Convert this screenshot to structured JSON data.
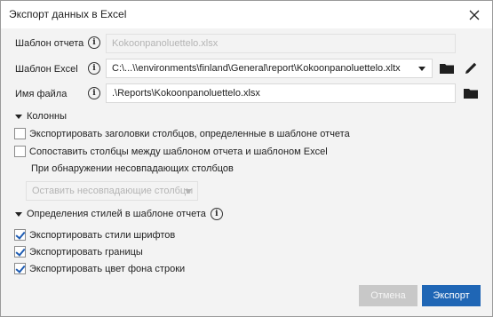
{
  "window": {
    "title": "Экспорт данных в Excel"
  },
  "fields": {
    "report_template": {
      "label": "Шаблон отчета",
      "value": "Kokoonpanoluettelo.xlsx"
    },
    "excel_template": {
      "label": "Шаблон Excel",
      "value": "C:\\...\\\\environments\\finland\\General\\report\\Kokoonpanoluettelo.xltx"
    },
    "file_name": {
      "label": "Имя файла",
      "value": ".\\Reports\\Kokoonpanoluettelo.xlsx"
    }
  },
  "columns": {
    "header": "Колонны",
    "export_headers_label": "Экспортировать заголовки столбцов, определенные в шаблоне отчета",
    "export_headers_checked": false,
    "match_columns_label": "Сопоставить столбцы между шаблоном отчета и шаблоном Excel",
    "match_columns_checked": false,
    "mismatch_label": "При обнаружении несовпадающих столбцов",
    "mismatch_option": "Оставить несовпадающие столбцы"
  },
  "styles": {
    "header": "Определения стилей в шаблоне отчета",
    "fonts_label": "Экспортировать стили шрифтов",
    "fonts_checked": true,
    "borders_label": "Экспортировать границы",
    "borders_checked": true,
    "row_bg_label": "Экспортировать цвет фона строки",
    "row_bg_checked": true
  },
  "buttons": {
    "cancel": "Отмена",
    "export": "Экспорт"
  },
  "colors": {
    "accent": "#1f66b5",
    "check": "#1e5cb3",
    "disabled_text": "#b4b4b4"
  },
  "icons": [
    "close-icon",
    "info-icon",
    "chevron-down-icon",
    "folder-icon",
    "pencil-icon",
    "caret-down-icon",
    "checkmark-icon"
  ]
}
